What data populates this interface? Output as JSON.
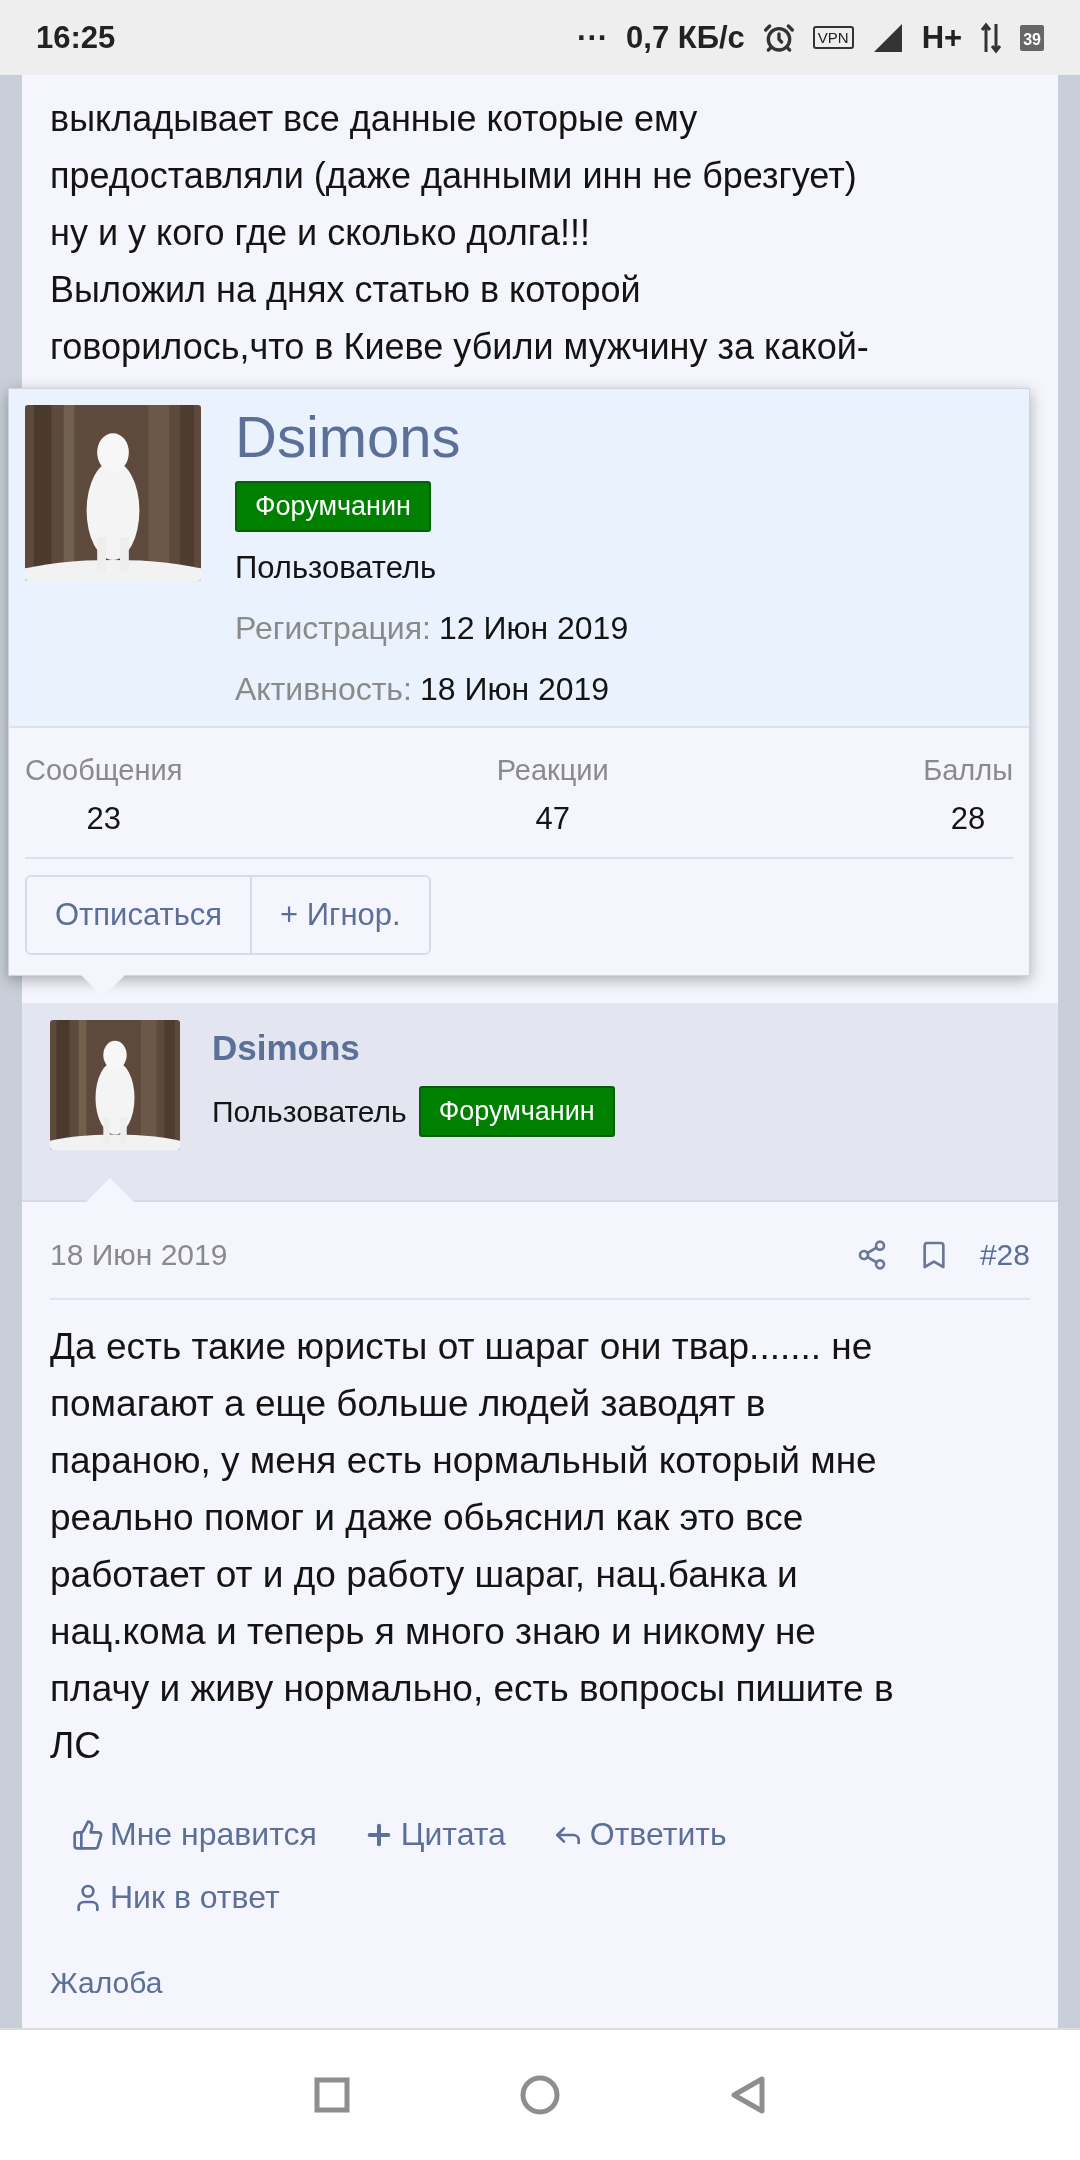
{
  "status_bar": {
    "time": "16:25",
    "overflow": "···",
    "speed": "0,7 КБ/с",
    "vpn": "VPN",
    "network": "H+",
    "battery": "39"
  },
  "previous_post": {
    "text": "выкладывает все данные которые ему\nпредоставляли (даже данными инн не брезгует)\nну и у кого где и сколько долга!!!\nВыложил на днях статью в которой\nговорилось,что в Киеве убили мужчину за какой-"
  },
  "member_card": {
    "name": "Dsimons",
    "badge": "Форумчанин",
    "role": "Пользователь",
    "details": [
      {
        "label": "Регистрация:",
        "value": "12 Июн 2019"
      },
      {
        "label": "Активность:",
        "value": "18 Июн 2019"
      }
    ],
    "stats": [
      {
        "label": "Сообщения",
        "value": "23"
      },
      {
        "label": "Реакции",
        "value": "47"
      },
      {
        "label": "Баллы",
        "value": "28"
      }
    ],
    "buttons": [
      "Отписаться",
      "+ Игнор."
    ]
  },
  "post": {
    "author": {
      "name": "Dsimons",
      "role": "Пользователь",
      "badge": "Форумчанин"
    },
    "date": "18 Июн 2019",
    "number": "#28",
    "body": "Да есть такие юристы от шараг они твар....... не\nпомагают а еще больше людей заводят в\nпараною, у меня есть нормальный который мне\nреально помог и даже обьяснил как это все\nработает от и до работу шараг, нац.банка и\nнац.кома и теперь я много знаю и никому не\nплачу и живу нормально, есть вопросы пишите в\nЛС",
    "actions": [
      {
        "kind": "like",
        "label": "Мне нравится"
      },
      {
        "kind": "quote",
        "label": "Цитата"
      },
      {
        "kind": "reply",
        "label": "Ответить"
      },
      {
        "kind": "mention",
        "label": "Ник в ответ"
      }
    ],
    "report": "Жалоба"
  }
}
